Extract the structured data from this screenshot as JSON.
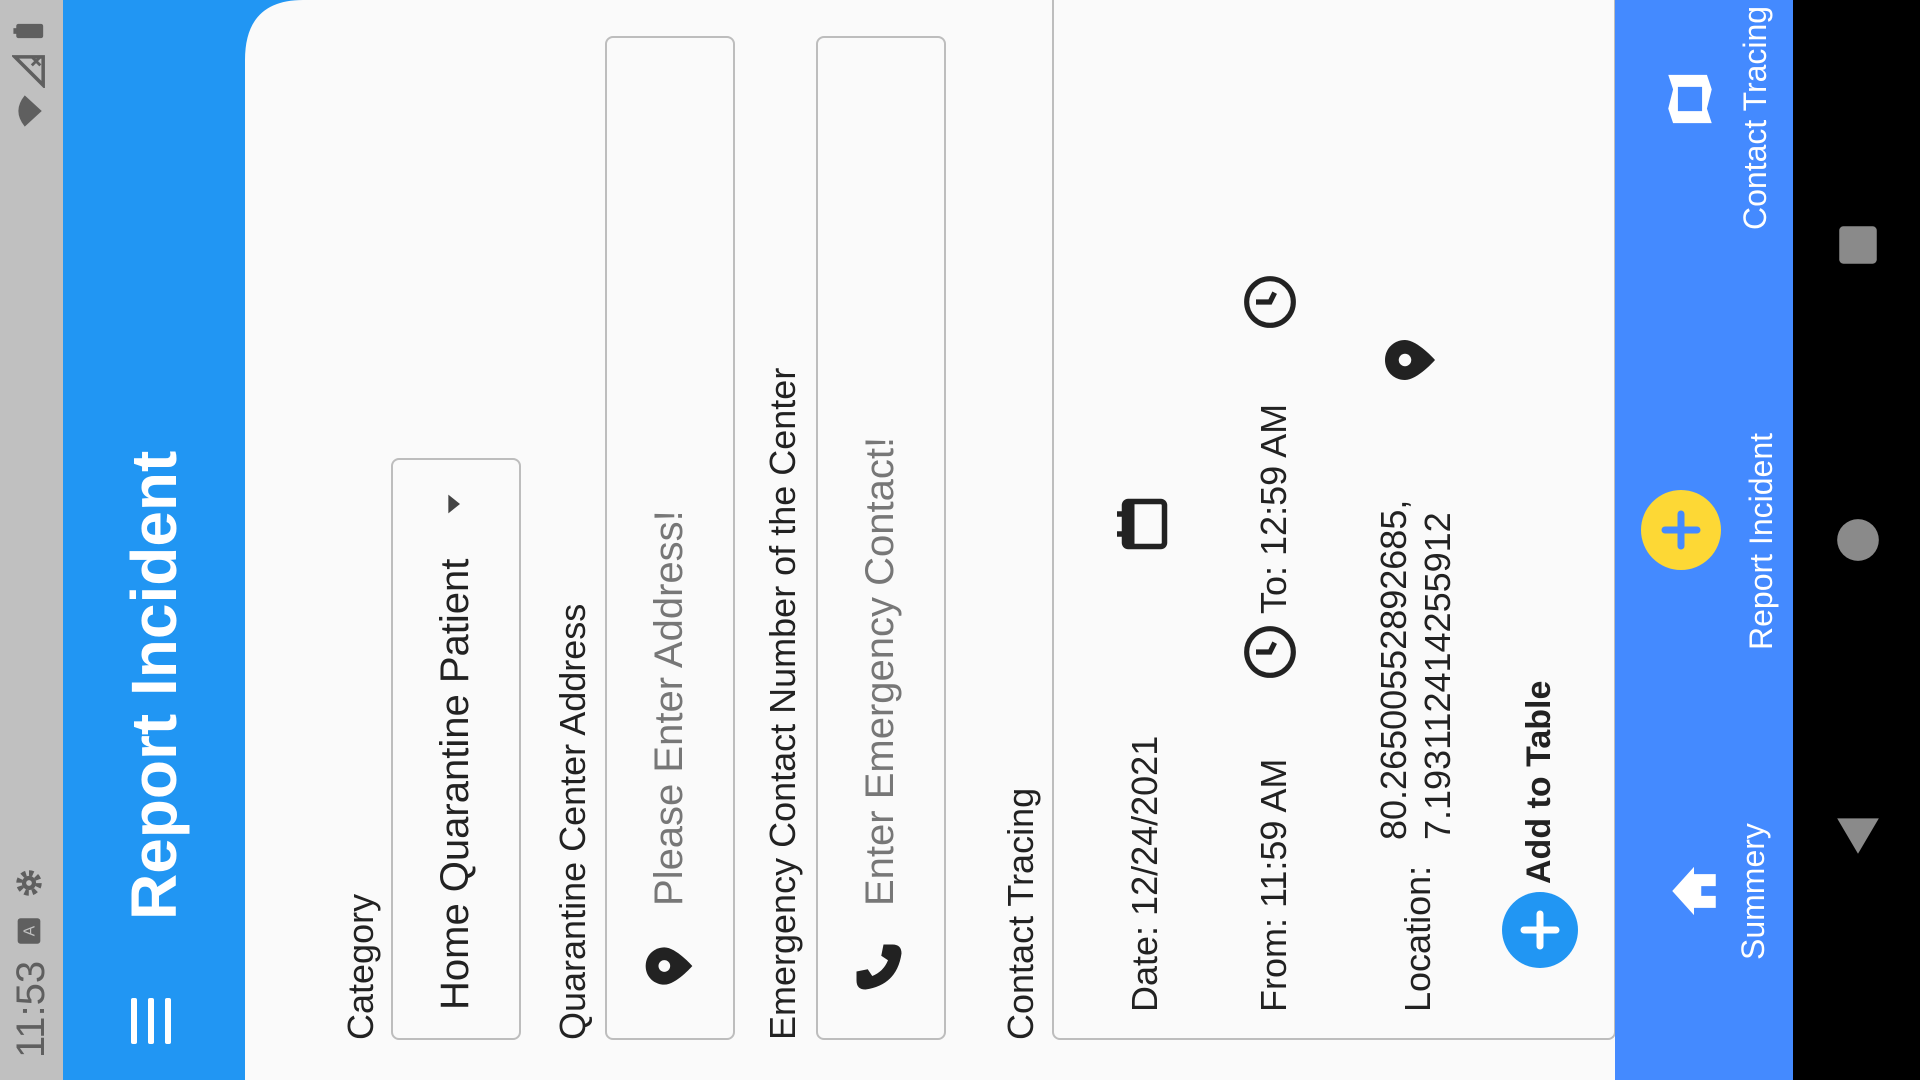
{
  "status_bar": {
    "time": "11:53"
  },
  "app_bar": {
    "title": "Report Incident"
  },
  "form": {
    "category": {
      "label": "Category",
      "value": "Home Quarantine Patient"
    },
    "address": {
      "label": "Quarantine Center Address",
      "placeholder": "Please Enter Address!"
    },
    "emergency": {
      "label": "Emergency Contact Number of the Center",
      "placeholder": "Enter Emergency Contact!"
    },
    "contact_tracing": {
      "label": "Contact Tracing",
      "date": "Date: 12/24/2021",
      "from": "From: 11:59 AM",
      "to": "To: 12:59 AM",
      "location_label": "Location:",
      "location_line1": "80.26500552892685,",
      "location_line2": "7.193112414255912",
      "add_label": "Add to Table"
    }
  },
  "bottom_nav": {
    "items": [
      {
        "label": "Summery",
        "icon": "home-icon"
      },
      {
        "label": "Report Incident",
        "icon": "add-circle-icon"
      },
      {
        "label": "Contact Tracing",
        "icon": "map-icon"
      }
    ]
  },
  "colors": {
    "primary": "#2196f3",
    "bottom_nav": "#448aff",
    "fab": "#fdd835"
  }
}
